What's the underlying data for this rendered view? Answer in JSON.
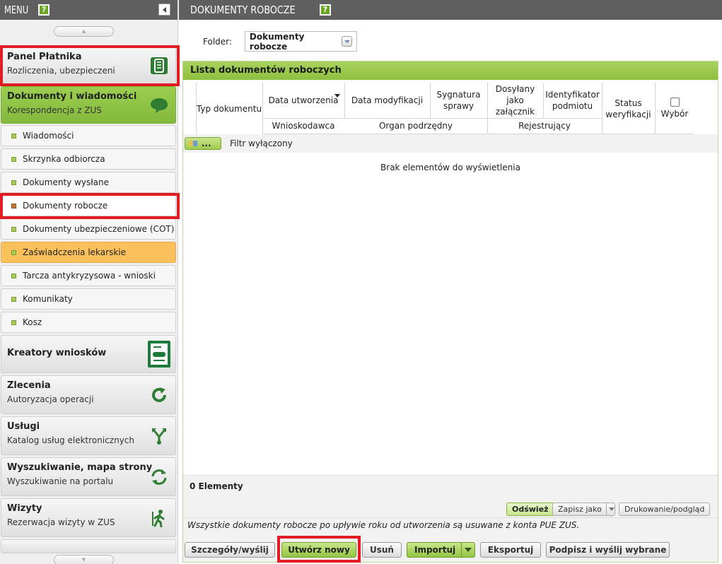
{
  "sidebar": {
    "title": "MENU",
    "help_label": "?",
    "panel": {
      "title": "Panel Płatnika",
      "subtitle": "Rozliczenia, ubezpieczeni"
    },
    "docs": {
      "title": "Dokumenty i wiadomości",
      "subtitle": "Korespondencja z ZUS"
    },
    "items": [
      {
        "label": "Wiadomości"
      },
      {
        "label": "Skrzynka odbiorcza"
      },
      {
        "label": "Dokumenty wysłane"
      },
      {
        "label": "Dokumenty robocze"
      },
      {
        "label": "Dokumenty ubezpieczeniowe (COT)"
      },
      {
        "label": "Zaświadczenia lekarskie"
      },
      {
        "label": "Tarcza antykryzysowa - wnioski"
      },
      {
        "label": "Komunikaty"
      },
      {
        "label": "Kosz"
      }
    ],
    "kreatory": {
      "title": "Kreatory wniosków"
    },
    "zlecenia": {
      "title": "Zlecenia",
      "subtitle": "Autoryzacja operacji"
    },
    "uslugi": {
      "title": "Usługi",
      "subtitle": "Katalog usług elektronicznych"
    },
    "wyszukiwanie": {
      "title": "Wyszukiwanie, mapa strony",
      "subtitle": "Wyszukiwanie na portalu"
    },
    "wizyty": {
      "title": "Wizyty",
      "subtitle": "Rezerwacja wizyty w ZUS"
    }
  },
  "header": {
    "title": "DOKUMENTY ROBOCZE",
    "help_label": "?"
  },
  "folder": {
    "label": "Folder:",
    "value": "Dokumenty robocze"
  },
  "list": {
    "title": "Lista dokumentów roboczych",
    "columns": {
      "typ": "Typ dokumentu",
      "data_utw": "Data utworzenia",
      "data_mod": "Data modyfikacji",
      "sygnatura": "Sygnatura sprawy",
      "dosylany": "Dosyłany jako załącznik",
      "identyfikator": "Identyfikator podmiotu",
      "status": "Status weryfikacji",
      "wybor": "Wybór",
      "wnioskodawca": "Wnioskodawca",
      "organ": "Organ podrzędny",
      "rejestrujacy": "Rejestrujący"
    },
    "filter_button": "...",
    "filter_text": "Filtr wyłączony",
    "empty_message": "Brak elementów do wyświetlenia",
    "count": "0 Elementy"
  },
  "tools": {
    "refresh": "Odśwież",
    "save_as": "Zapisz jako",
    "print": "Drukowanie/podgląd"
  },
  "note": "Wszystkie dokumenty robocze po upływie roku od utworzenia są usuwane z konta PUE ZUS.",
  "actions": {
    "details": "Szczegóły/wyślij",
    "create": "Utwórz nowy",
    "delete": "Usuń",
    "import": "Importuj",
    "export": "Eksportuj",
    "sign_send": "Podpisz i wyślij wybrane"
  },
  "colors": {
    "accent_green": "#8fc03f",
    "header_gray": "#5f5f5f",
    "highlight_red": "#e31b23",
    "orange_item": "#f9c05b"
  }
}
